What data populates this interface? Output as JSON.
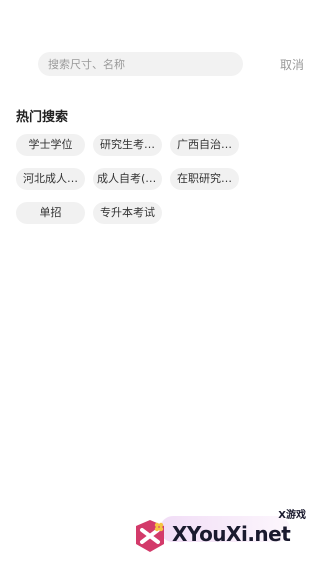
{
  "search": {
    "placeholder": "搜索尺寸、名称",
    "cancel_label": "取消"
  },
  "hot_search": {
    "title": "热门搜索",
    "rows": [
      [
        "学士学位",
        "研究生考…",
        "广西自治…"
      ],
      [
        "河北成人…",
        "成人自考(3…",
        "在职研究…"
      ],
      [
        "单招",
        "专升本考试"
      ]
    ]
  },
  "watermark": {
    "brand": "XYouXi.net",
    "chinese": "X游戏"
  }
}
